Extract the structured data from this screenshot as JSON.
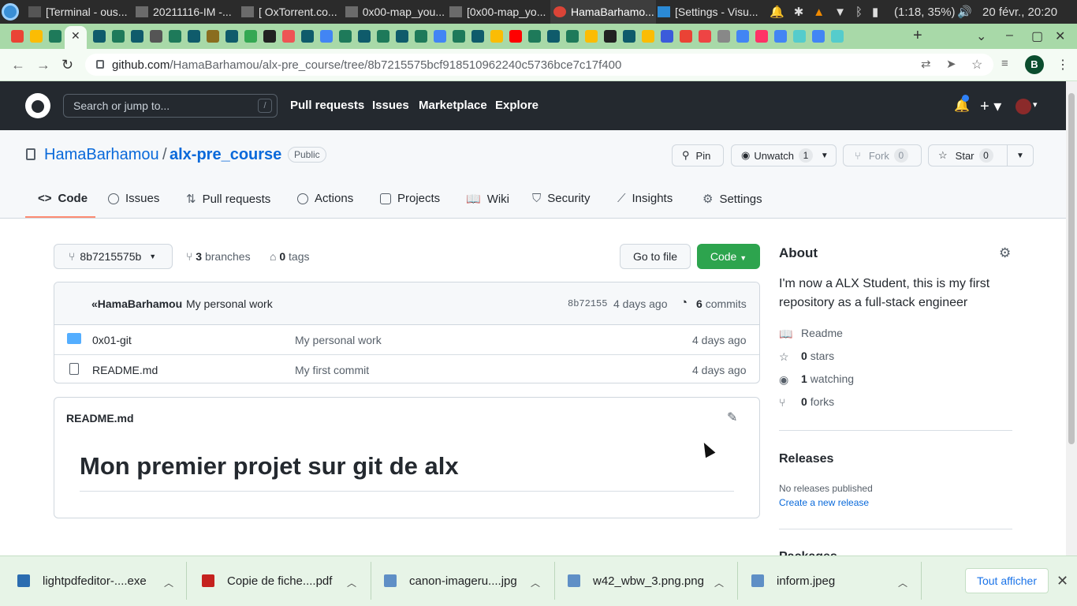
{
  "os": {
    "tabs": [
      {
        "label": "[Terminal - ous..."
      },
      {
        "label": "20211116-IM -..."
      },
      {
        "label": "[ OxTorrent.co..."
      },
      {
        "label": "0x00-map_you..."
      },
      {
        "label": "[0x00-map_yo..."
      },
      {
        "label": "HamaBarhamo..."
      },
      {
        "label": "[Settings - Visu..."
      }
    ],
    "battery": "(1:18, 35%)",
    "datetime": "20 févr., 20:20"
  },
  "browser": {
    "url_host": "github.com",
    "url_path": "/HamaBarhamou/alx-pre_course/tree/8b7215575bcf918510962240c5736bce7c17f400",
    "profile_initial": "B"
  },
  "github": {
    "search_placeholder": "Search or jump to...",
    "slash_key": "/",
    "nav": [
      "Pull requests",
      "Issues",
      "Marketplace",
      "Explore"
    ]
  },
  "repo": {
    "owner": "HamaBarhamou",
    "separator": "/",
    "name": "alx-pre_course",
    "visibility": "Public",
    "pin_label": "Pin",
    "unwatch_label": "Unwatch",
    "watch_count": "1",
    "fork_label": "Fork",
    "fork_count": "0",
    "star_label": "Star",
    "star_count": "0",
    "tabs": [
      {
        "label": "Code"
      },
      {
        "label": "Issues"
      },
      {
        "label": "Pull requests"
      },
      {
        "label": "Actions"
      },
      {
        "label": "Projects"
      },
      {
        "label": "Wiki"
      },
      {
        "label": "Security"
      },
      {
        "label": "Insights"
      },
      {
        "label": "Settings"
      }
    ]
  },
  "main": {
    "branch": "8b7215575b",
    "branches_count": "3",
    "branches_label": "branches",
    "tags_count": "0",
    "tags_label": "tags",
    "goto_file": "Go to file",
    "code_button": "Code",
    "commit": {
      "author": "«HamaBarhamou",
      "message": "My personal work",
      "sha": "8b72155",
      "age": "4 days ago",
      "commits_count": "6",
      "commits_label": "commits"
    },
    "files": [
      {
        "name": "0x01-git",
        "type": "folder",
        "message": "My personal work",
        "age": "4 days ago"
      },
      {
        "name": "README.md",
        "type": "file",
        "message": "My first commit",
        "age": "4 days ago"
      }
    ],
    "readme_title": "README.md",
    "readme_heading": "Mon premier projet sur git de alx"
  },
  "sidebar": {
    "about_title": "About",
    "description": "I'm now a ALX Student, this is my first repository as a full-stack engineer",
    "readme": "Readme",
    "stars_count": "0",
    "stars_label": "stars",
    "watching_count": "1",
    "watching_label": "watching",
    "forks_count": "0",
    "forks_label": "forks",
    "releases_title": "Releases",
    "no_releases": "No releases published",
    "create_release": "Create a new release",
    "packages_title": "Packages"
  },
  "downloads": {
    "items": [
      {
        "name": "lightpdfeditor-....exe",
        "icon": "windows-app-icon"
      },
      {
        "name": "Copie de fiche....pdf",
        "icon": "pdf-file-icon"
      },
      {
        "name": "canon-imageru....jpg",
        "icon": "image-file-icon"
      },
      {
        "name": "w42_wbw_3.png.png",
        "icon": "image-file-icon"
      },
      {
        "name": "inform.jpeg",
        "icon": "image-file-icon"
      }
    ],
    "show_all": "Tout afficher"
  },
  "colors": {
    "accent_green": "#2da44e",
    "link_blue": "#0969da",
    "header_dark": "#24292f",
    "tab_underline": "#fd8c73",
    "chrome_tab_green": "#a8d9a8"
  }
}
